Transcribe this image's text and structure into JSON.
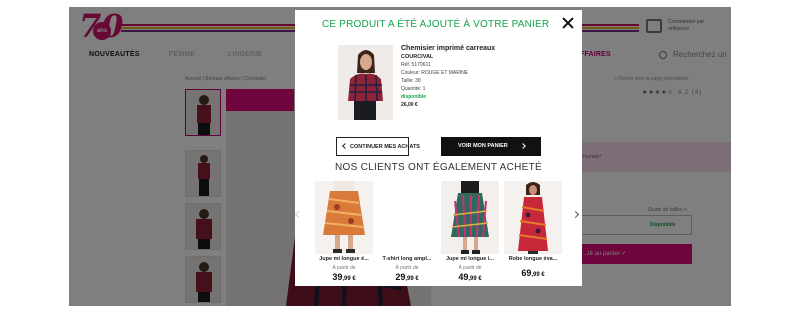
{
  "colors": {
    "brand": "#d0106a",
    "success": "#17a24a",
    "overlay": "rgba(0,0,0,0.5)"
  },
  "header": {
    "logo_text": "70",
    "logo_badge": "ans",
    "client_text": "Commander par référence"
  },
  "menu": {
    "items": [
      "NOUVEAUTÉS",
      "FEMME",
      "LINGERIE",
      "ES AFFAIRES"
    ],
    "search_placeholder": "Recherchez un"
  },
  "page": {
    "breadcrumb": "Accueil  |  Bonnes affaires  |  Chemisier",
    "back_link": "< Retour vers la page précédente",
    "rating": "4.2 (4)",
    "promo_text": "d'achats*",
    "size_guide": "Guide de tailles >",
    "availability": "Disponible",
    "add_to_cart": "...té au panier ✓"
  },
  "modal": {
    "title": "CE PRODUIT A ÉTÉ AJOUTÉ À VOTRE PANIER",
    "product": {
      "name": "Chemisier imprimé carreaux",
      "brand": "COURCIVAL",
      "ref": "Réf. 5170611",
      "color": "Couleur: ROUGE ET MARINE",
      "size": "Taille: 38",
      "quantity": "Quantité: 1",
      "status": "disponible",
      "price": "26,00 €"
    },
    "continue_label": "CONTINUER MES ACHATS",
    "cart_label": "VOIR MON PANIER",
    "reco_title": "NOS CLIENTS ONT ÉGALEMENT ACHETÉ",
    "recommendations": [
      {
        "name": "Jupe mi longue é...",
        "from": "À partir de",
        "price": "39,99 €"
      },
      {
        "name": "T-shirt long ampl...",
        "from": "À partir de",
        "price": "29,99 €"
      },
      {
        "name": "Jupe mi longue i...",
        "from": "À partir de",
        "price": "49,99 €"
      },
      {
        "name": "Robe longue éva...",
        "from": "",
        "price": "69,99 €"
      }
    ]
  }
}
